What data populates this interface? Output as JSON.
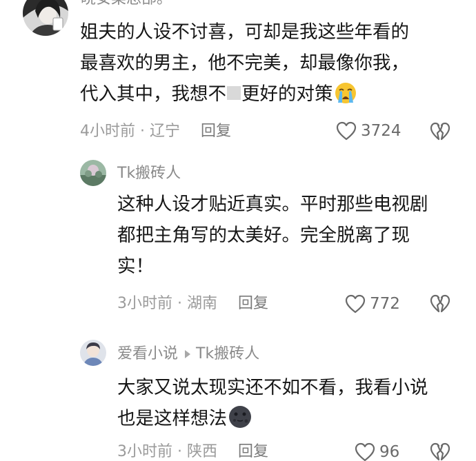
{
  "comments": [
    {
      "author_partial": "晓安菜总部。",
      "lines": [
        "姐夫的人设不讨喜，可却是我这些年看的",
        "最喜欢的男主，他不完美，却最像你我，",
        "代入其中，我想不"
      ],
      "line3_tail": "更好的对策",
      "time": "4小时前 · 辽宁",
      "reply_label": "回复",
      "likes": "3724"
    },
    {
      "author": "Tk搬砖人",
      "lines": [
        "这种人设才贴近真实。平时那些电视剧",
        "都把主角写的太美好。完全脱离了现",
        "实！"
      ],
      "time": "3小时前 · 湖南",
      "reply_label": "回复",
      "likes": "772"
    },
    {
      "author": "爱看小说",
      "reply_to": "Tk搬砖人",
      "lines": [
        "大家又说太现实还不如不看，我看小说",
        "也是这样想法"
      ],
      "time": "3小时前 · 陕西",
      "reply_label": "回复",
      "likes": "96"
    }
  ],
  "icons": {
    "like": "heart-outline-icon",
    "dislike": "broken-heart-icon",
    "emoji_1": "loudly-crying-face-emoji",
    "emoji_2": "dark-moon-face-emoji",
    "reply_arrow": "triangle-right-icon"
  }
}
